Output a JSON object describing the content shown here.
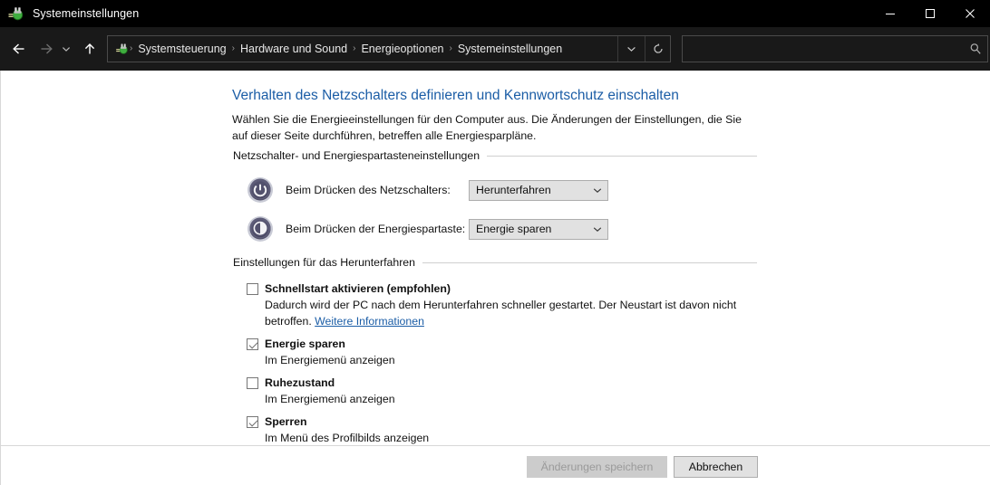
{
  "window": {
    "title": "Systemeinstellungen",
    "icon": "power-plug-icon",
    "controls": {
      "minimize": "minimize-icon",
      "maximize": "maximize-icon",
      "close": "close-icon"
    }
  },
  "addressbar": {
    "back": "back-arrow-icon",
    "forward": "forward-arrow-icon",
    "recent": "recent-locations-chevron-icon",
    "up": "up-arrow-icon",
    "breadcrumb_icon": "power-plug-icon",
    "breadcrumbs": [
      "Systemsteuerung",
      "Hardware und Sound",
      "Energieoptionen",
      "Systemeinstellungen"
    ],
    "separator": "›",
    "dropdown": "chevron-down-icon",
    "refresh": "refresh-icon",
    "search": {
      "value": "",
      "placeholder": "",
      "icon": "search-icon"
    }
  },
  "page": {
    "title": "Verhalten des Netzschalters definieren und Kennwortschutz einschalten",
    "description": "Wählen Sie die Energieeinstellungen für den Computer aus. Die Änderungen der Einstellungen, die Sie auf dieser Seite durchführen, betreffen alle Energiesparpläne."
  },
  "section_power": {
    "heading": "Netzschalter- und Energiespartasteneinstellungen",
    "rows": [
      {
        "icon": "power-button-icon",
        "label": "Beim Drücken des Netzschalters:",
        "value": "Herunterfahren",
        "arrow": "chevron-down-icon"
      },
      {
        "icon": "sleep-button-icon",
        "label": "Beim Drücken der Energiespartaste:",
        "value": "Energie sparen",
        "arrow": "chevron-down-icon"
      }
    ]
  },
  "section_shutdown": {
    "heading": "Einstellungen für das Herunterfahren",
    "items": [
      {
        "label": "Schnellstart aktivieren (empfohlen)",
        "checked": false,
        "sub_before": "Dadurch wird der PC nach dem Herunterfahren schneller gestartet. Der Neustart ist davon nicht betroffen. ",
        "link": "Weitere Informationen",
        "sub_after": ""
      },
      {
        "label": "Energie sparen",
        "checked": true,
        "sub_before": "Im Energiemenü anzeigen",
        "link": "",
        "sub_after": ""
      },
      {
        "label": "Ruhezustand",
        "checked": false,
        "sub_before": "Im Energiemenü anzeigen",
        "link": "",
        "sub_after": ""
      },
      {
        "label": "Sperren",
        "checked": true,
        "sub_before": "Im Menü des Profilbilds anzeigen",
        "link": "",
        "sub_after": ""
      }
    ]
  },
  "footer": {
    "save_label": "Änderungen speichern",
    "save_disabled": true,
    "cancel_label": "Abbrechen"
  },
  "colors": {
    "titlebar_bg": "#000000",
    "addressbar_bg": "#191919",
    "link": "#1b5da6",
    "heading": "#1b5da6",
    "combo_bg": "#e1e1e1",
    "button_bg": "#e1e1e1",
    "button_disabled_bg": "#cccccc"
  }
}
